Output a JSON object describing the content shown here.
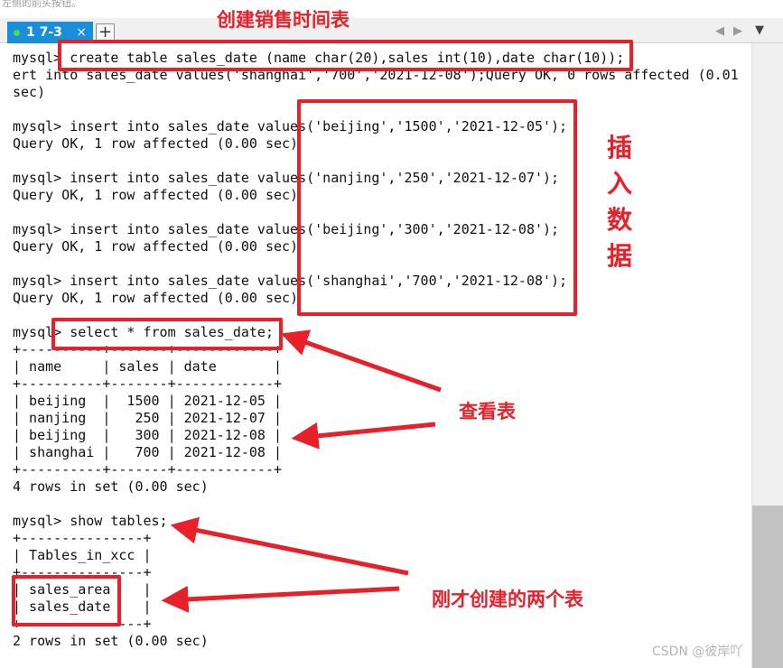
{
  "hint": "左侧的前头按钮。",
  "tabs": {
    "active_label": "1 7-3",
    "close_glyph": "×",
    "add_glyph": "+",
    "nav_left": "◀",
    "nav_right": "▶",
    "menu_glyph": "▼"
  },
  "terminal": {
    "lines": [
      "mysql> create table sales_date (name char(20),sales int(10),date char(10));",
      "ert into sales_date values('shanghai','700','2021-12-08');Query OK, 0 rows affected (0.01",
      "sec)",
      "",
      "mysql> insert into sales_date values('beijing','1500','2021-12-05');",
      "Query OK, 1 row affected (0.00 sec)",
      "",
      "mysql> insert into sales_date values('nanjing','250','2021-12-07');",
      "Query OK, 1 row affected (0.00 sec)",
      "",
      "mysql> insert into sales_date values('beijing','300','2021-12-08');",
      "Query OK, 1 row affected (0.00 sec)",
      "",
      "mysql> insert into sales_date values('shanghai','700','2021-12-08');",
      "Query OK, 1 row affected (0.00 sec)",
      "",
      "mysql> select * from sales_date;",
      "+----------+-------+------------+",
      "| name     | sales | date       |",
      "+----------+-------+------------+",
      "| beijing  |  1500 | 2021-12-05 |",
      "| nanjing  |   250 | 2021-12-07 |",
      "| beijing  |   300 | 2021-12-08 |",
      "| shanghai |   700 | 2021-12-08 |",
      "+----------+-------+------------+",
      "4 rows in set (0.00 sec)",
      "",
      "mysql> show tables;",
      "+---------------+",
      "| Tables_in_xcc |",
      "+---------------+",
      "| sales_area    |",
      "| sales_date    |",
      "+---------------+",
      "2 rows in set (0.00 sec)"
    ]
  },
  "annotations": {
    "create_note": "创建销售时间表",
    "insert_note": "插入数据",
    "view_note": "查看表",
    "tables_note": "刚才创建的两个表",
    "color": "#e8202a"
  },
  "watermark": "CSDN @彼岸吖"
}
